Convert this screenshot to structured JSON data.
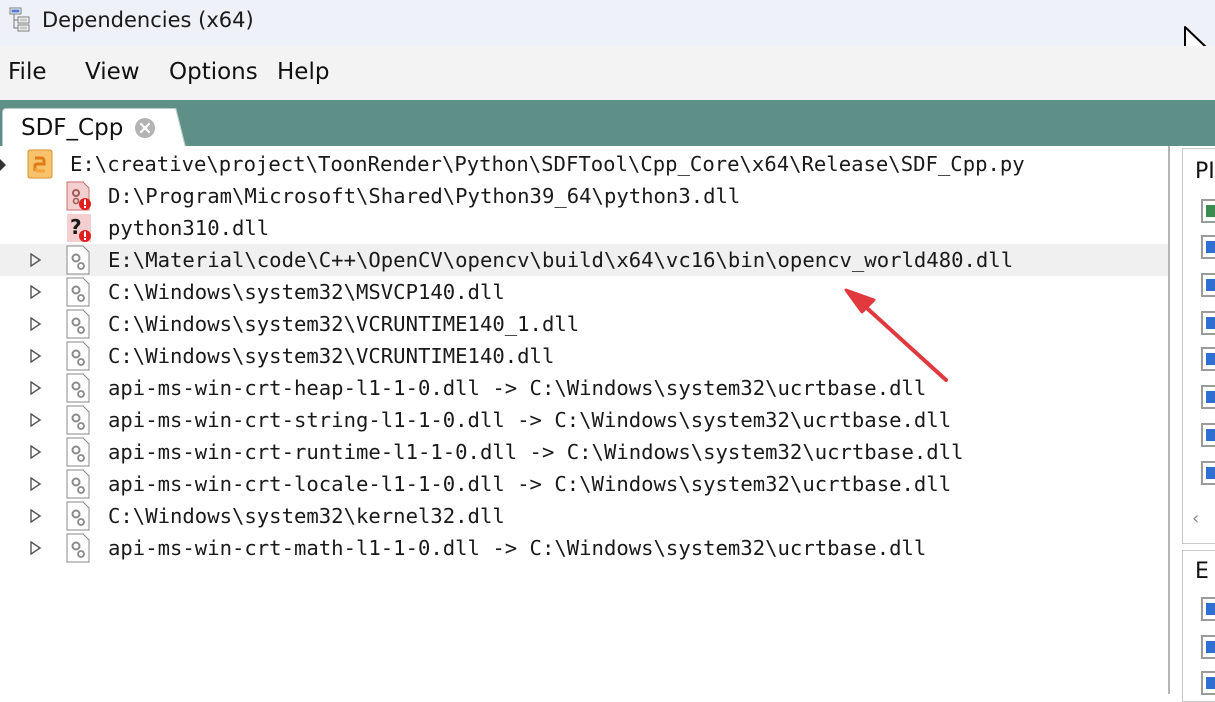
{
  "window": {
    "title": "Dependencies (x64)",
    "icon": "tree-view-app-icon"
  },
  "menu": {
    "items": [
      "File",
      "View",
      "Options",
      "Help"
    ]
  },
  "tab": {
    "label": "SDF_Cpp",
    "close_icon": "close-circle-icon",
    "strip_color": "#5f9087"
  },
  "tree": {
    "root": {
      "path": "E:\\creative\\project\\ToonRender\\Python\\SDFTool\\Cpp_Core\\x64\\Release\\SDF_Cpp.py",
      "icon": "python-module-icon"
    },
    "items": [
      {
        "text": "D:\\Program\\Microsoft\\Shared\\Python39_64\\python3.dll",
        "icon": "dll-error-icon",
        "expandable": false
      },
      {
        "text": "python310.dll",
        "icon": "missing-dll-icon",
        "expandable": false
      },
      {
        "text": "E:\\Material\\code\\C++\\OpenCV\\opencv\\build\\x64\\vc16\\bin\\opencv_world480.dll",
        "icon": "dll-icon",
        "expandable": true,
        "selected": true
      },
      {
        "text": "C:\\Windows\\system32\\MSVCP140.dll",
        "icon": "dll-icon",
        "expandable": true
      },
      {
        "text": "C:\\Windows\\system32\\VCRUNTIME140_1.dll",
        "icon": "dll-icon",
        "expandable": true
      },
      {
        "text": "C:\\Windows\\system32\\VCRUNTIME140.dll",
        "icon": "dll-icon",
        "expandable": true
      },
      {
        "text": "api-ms-win-crt-heap-l1-1-0.dll -> C:\\Windows\\system32\\ucrtbase.dll",
        "icon": "dll-icon",
        "expandable": true
      },
      {
        "text": "api-ms-win-crt-string-l1-1-0.dll -> C:\\Windows\\system32\\ucrtbase.dll",
        "icon": "dll-icon",
        "expandable": true
      },
      {
        "text": "api-ms-win-crt-runtime-l1-1-0.dll -> C:\\Windows\\system32\\ucrtbase.dll",
        "icon": "dll-icon",
        "expandable": true
      },
      {
        "text": "api-ms-win-crt-locale-l1-1-0.dll -> C:\\Windows\\system32\\ucrtbase.dll",
        "icon": "dll-icon",
        "expandable": true
      },
      {
        "text": "C:\\Windows\\system32\\kernel32.dll",
        "icon": "dll-icon",
        "expandable": true
      },
      {
        "text": "api-ms-win-crt-math-l1-1-0.dll -> C:\\Windows\\system32\\ucrtbase.dll",
        "icon": "dll-icon",
        "expandable": true
      }
    ]
  },
  "right_panels": {
    "top_header": "PI",
    "bottom_header": "E"
  },
  "annotation": {
    "type": "red-arrow",
    "color": "#e0393e"
  }
}
